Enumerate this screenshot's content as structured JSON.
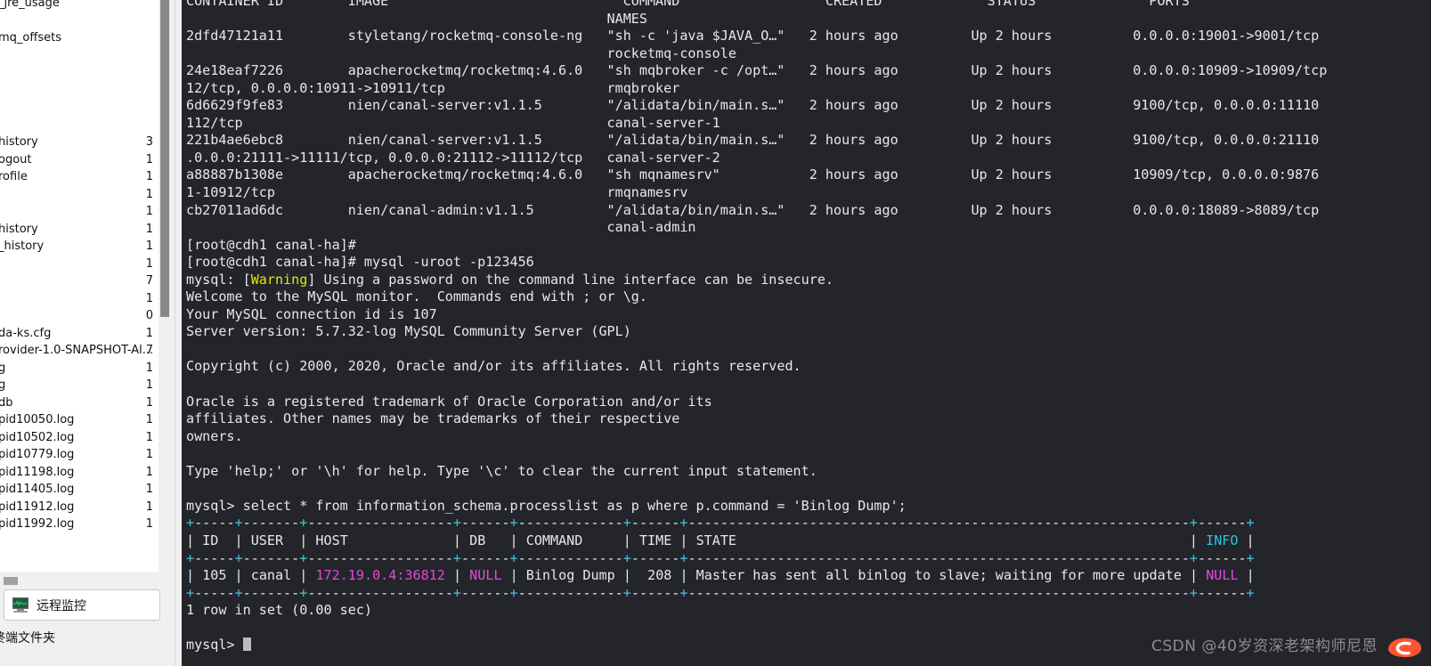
{
  "sidebar": {
    "files": [
      {
        "name": "_jre_usage",
        "size": ""
      },
      {
        "name": "",
        "size": ""
      },
      {
        "name": "mq_offsets",
        "size": ""
      },
      {
        "name": "",
        "size": ""
      },
      {
        "name": "",
        "size": ""
      },
      {
        "name": "",
        "size": ""
      },
      {
        "name": "",
        "size": ""
      },
      {
        "name": "",
        "size": ""
      },
      {
        "name": "history",
        "size": "3"
      },
      {
        "name": "ogout",
        "size": "1"
      },
      {
        "name": "rofile",
        "size": "1"
      },
      {
        "name": "",
        "size": "1"
      },
      {
        "name": "",
        "size": "1"
      },
      {
        "name": "history",
        "size": "1"
      },
      {
        "name": "_history",
        "size": "1"
      },
      {
        "name": "",
        "size": "1"
      },
      {
        "name": "",
        "size": "7"
      },
      {
        "name": "",
        "size": "1"
      },
      {
        "name": "",
        "size": "0"
      },
      {
        "name": "da-ks.cfg",
        "size": "1"
      },
      {
        "name": "rovider-1.0-SNAPSHOT-Al...",
        "size": "7"
      },
      {
        "name": "g",
        "size": "1"
      },
      {
        "name": "g",
        "size": "1"
      },
      {
        "name": "db",
        "size": "1"
      },
      {
        "name": "pid10050.log",
        "size": "1"
      },
      {
        "name": "pid10502.log",
        "size": "1"
      },
      {
        "name": "pid10779.log",
        "size": "1"
      },
      {
        "name": "pid11198.log",
        "size": "1"
      },
      {
        "name": "pid11405.log",
        "size": "1"
      },
      {
        "name": "pid11912.log",
        "size": "1"
      },
      {
        "name": "pid11992.log",
        "size": "1"
      }
    ],
    "remote_monitor_label": "远程监控",
    "terminal_folder_label": "终端文件夹"
  },
  "terminal": {
    "docker_header": {
      "line1": "CONTAINER ID        IMAGE                             COMMAND                  CREATED             STATUS              PORTS",
      "line2": "                                                    NAMES"
    },
    "docker_rows": [
      {
        "line_a": "2dfd47121a11        styletang/rocketmq-console-ng   \"sh -c 'java $JAVA_O…\"   2 hours ago         Up 2 hours          0.0.0.0:19001->9001/tcp",
        "line_b": "                                                    rocketmq-console"
      },
      {
        "line_a": "24e18eaf7226        apacherocketmq/rocketmq:4.6.0   \"sh mqbroker -c /opt…\"   2 hours ago         Up 2 hours          0.0.0.0:10909->10909/tcp",
        "line_b": "12/tcp, 0.0.0.0:10911->10911/tcp                    rmqbroker"
      },
      {
        "line_a": "6d6629f9fe83        nien/canal-server:v1.1.5        \"/alidata/bin/main.s…\"   2 hours ago         Up 2 hours          9100/tcp, 0.0.0.0:11110",
        "line_b": "112/tcp                                             canal-server-1"
      },
      {
        "line_a": "221b4ae6ebc8        nien/canal-server:v1.1.5        \"/alidata/bin/main.s…\"   2 hours ago         Up 2 hours          9100/tcp, 0.0.0.0:21110",
        "line_b": ".0.0.0:21111->11111/tcp, 0.0.0.0:21112->11112/tcp   canal-server-2"
      },
      {
        "line_a": "a88887b1308e        apacherocketmq/rocketmq:4.6.0   \"sh mqnamesrv\"           2 hours ago         Up 2 hours          10909/tcp, 0.0.0.0:9876",
        "line_b": "1-10912/tcp                                         rmqnamesrv"
      },
      {
        "line_a": "cb27011ad6dc        nien/canal-admin:v1.1.5         \"/alidata/bin/main.s…\"   2 hours ago         Up 2 hours          0.0.0.0:18089->8089/tcp",
        "line_b": "                                                    canal-admin"
      }
    ],
    "prompt1": "[root@cdh1 canal-ha]#",
    "prompt2_prefix": "[root@cdh1 canal-ha]# ",
    "prompt2_cmd": "mysql -uroot -p123456",
    "warning_prefix": "mysql: [",
    "warning_word": "Warning",
    "warning_suffix": "] Using a password on the command line interface can be insecure.",
    "welcome_lines": [
      "Welcome to the MySQL monitor.  Commands end with ; or \\g.",
      "Your MySQL connection id is 107",
      "Server version: 5.7.32-log MySQL Community Server (GPL)"
    ],
    "copyright": "Copyright (c) 2000, 2020, Oracle and/or its affiliates. All rights reserved.",
    "trademark_lines": [
      "Oracle is a registered trademark of Oracle Corporation and/or its",
      "affiliates. Other names may be trademarks of their respective",
      "owners."
    ],
    "help_line": "Type 'help;' or '\\h' for help. Type '\\c' to clear the current input statement.",
    "sql_prompt": "mysql> ",
    "sql_query": "select * from information_schema.processlist as p where p.command = 'Binlog Dump';",
    "result_footer": "1 row in set (0.00 sec)",
    "final_prompt": "mysql> "
  },
  "sql_result": {
    "separator_segments": [
      "-----",
      "-------",
      "----------------",
      "------",
      "-------------",
      "------",
      "------------------------------------------------------",
      "------"
    ],
    "headers": [
      "ID",
      "USER",
      "HOST",
      "DB",
      "COMMAND",
      "TIME",
      "STATE",
      "INFO"
    ],
    "row": {
      "id": "105",
      "user": "canal",
      "host": "172.19.0.4:36812",
      "db": "NULL",
      "command": "Binlog Dump",
      "time": "208",
      "state": "Master has sent all binlog to slave; waiting for more updates",
      "info": "NULL"
    }
  },
  "watermark": {
    "text": "CSDN @40岁资深老架构师尼恩"
  },
  "colors": {
    "terminal_bg": "#23252b",
    "text": "#e8e8e8",
    "warning": "#e5e510",
    "magenta": "#e24ad6",
    "cyan": "#26c6da",
    "panel_bg": "#f0f0f0"
  }
}
